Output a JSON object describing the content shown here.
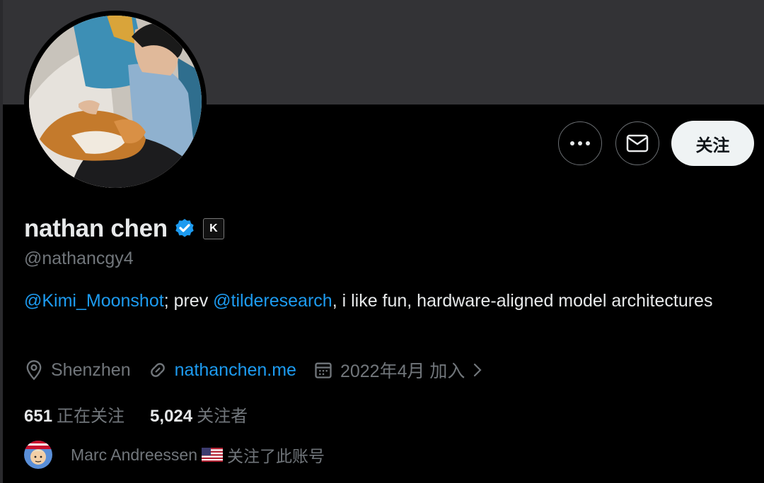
{
  "profile": {
    "name": "nathan chen",
    "handle": "@nathancgy4",
    "affiliate_badge": "K",
    "bio": {
      "mention1": "@Kimi_Moonshot",
      "text1": "; prev ",
      "mention2": "@tilderesearch",
      "text2": ", i like fun, hardware-aligned model architectures"
    },
    "location": "Shenzhen",
    "website": "nathanchen.me",
    "joined": "2022年4月 加入",
    "following_count": "651",
    "following_label": "正在关注",
    "followers_count": "5,024",
    "followers_label": "关注者"
  },
  "actions": {
    "follow_label": "关注",
    "more_icon": "more-icon",
    "message_icon": "envelope-icon"
  },
  "followed_by": {
    "name": "Marc Andreessen",
    "text": "关注了此账号"
  },
  "colors": {
    "accent": "#1d9bf0",
    "secondary_text": "#71767b",
    "banner": "#333336",
    "follow_button_bg": "#eff3f4"
  }
}
